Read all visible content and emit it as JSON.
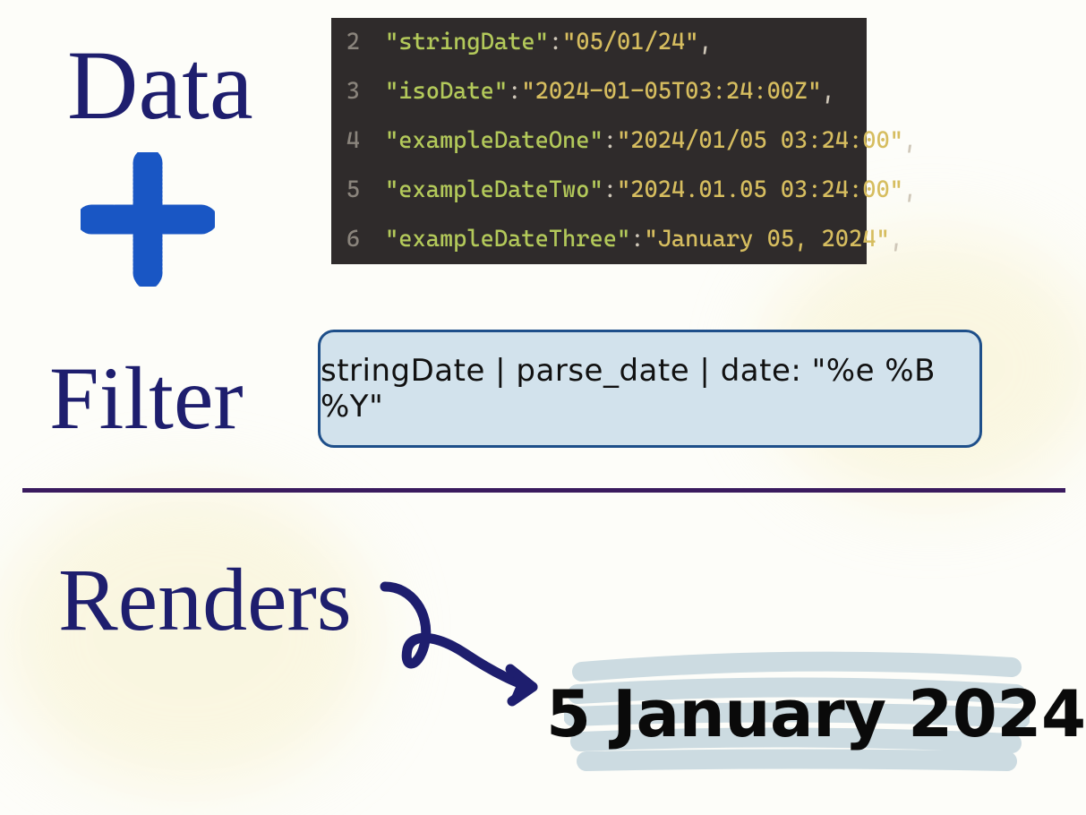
{
  "labels": {
    "data": "Data",
    "filter": "Filter",
    "renders": "Renders"
  },
  "code": {
    "lines": [
      {
        "num": "2",
        "key": "stringDate",
        "value": "05/01/24"
      },
      {
        "num": "3",
        "key": "isoDate",
        "value": "2024-01-05T03:24:00Z"
      },
      {
        "num": "4",
        "key": "exampleDateOne",
        "value": "2024/01/05 03:24:00"
      },
      {
        "num": "5",
        "key": "exampleDateTwo",
        "value": "2024.01.05 03:24:00"
      },
      {
        "num": "6",
        "key": "exampleDateThree",
        "value": "January 05, 2024"
      }
    ]
  },
  "filter_expression": "stringDate | parse_date | date: \"%e %B %Y\"",
  "output": "5 January 2024",
  "colors": {
    "handwriting": "#1e1e6e",
    "plus": "#1a56c4",
    "code_bg": "#2f2b2b",
    "code_key": "#b3c95a",
    "code_string": "#d6bd5f",
    "code_punct": "#cfc7b8",
    "filter_bg": "#d2e2ec",
    "filter_border": "#1e4f8a",
    "divider": "#3a1b5e",
    "highlight": "#c7d7de"
  }
}
